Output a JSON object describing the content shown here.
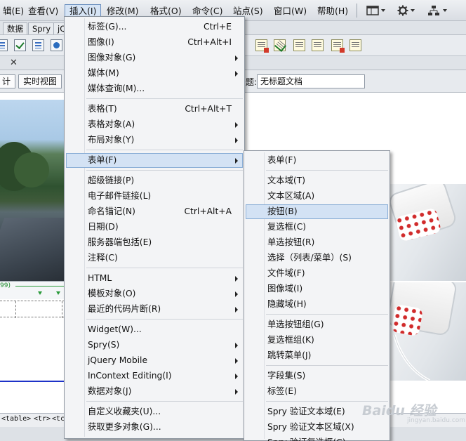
{
  "menubar": {
    "items": [
      "辑(E)",
      "查看(V)",
      "插入(I)",
      "修改(M)",
      "格式(O)",
      "命令(C)",
      "站点(S)",
      "窗口(W)",
      "帮助(H)"
    ],
    "active_index": 2,
    "icons": [
      "layout-icon",
      "gear-icon",
      "site-icon"
    ]
  },
  "panel_tabs": [
    "数据",
    "Spry",
    "jQ"
  ],
  "doc_toolbar": {
    "buttons": [
      "计",
      "实时视图"
    ],
    "title_label": "题:",
    "title_value": "无标题文档"
  },
  "ruler": {
    "width_label": "99)"
  },
  "status_tags": [
    "<table>",
    "<tr>",
    "<tc"
  ],
  "insert_menu": {
    "items": [
      {
        "label": "标签(G)...",
        "shortcut": "Ctrl+E",
        "submenu": false
      },
      {
        "label": "图像(I)",
        "shortcut": "Ctrl+Alt+I",
        "submenu": false
      },
      {
        "label": "图像对象(G)",
        "shortcut": "",
        "submenu": true
      },
      {
        "label": "媒体(M)",
        "shortcut": "",
        "submenu": true
      },
      {
        "label": "媒体查询(M)...",
        "shortcut": "",
        "submenu": false
      },
      {
        "label": "表格(T)",
        "shortcut": "Ctrl+Alt+T",
        "submenu": false
      },
      {
        "label": "表格对象(A)",
        "shortcut": "",
        "submenu": true
      },
      {
        "label": "布局对象(Y)",
        "shortcut": "",
        "submenu": true
      },
      {
        "label": "表单(F)",
        "shortcut": "",
        "submenu": true
      },
      {
        "label": "超级链接(P)",
        "shortcut": "",
        "submenu": false
      },
      {
        "label": "电子邮件链接(L)",
        "shortcut": "",
        "submenu": false
      },
      {
        "label": "命名锚记(N)",
        "shortcut": "Ctrl+Alt+A",
        "submenu": false
      },
      {
        "label": "日期(D)",
        "shortcut": "",
        "submenu": false
      },
      {
        "label": "服务器端包括(E)",
        "shortcut": "",
        "submenu": false
      },
      {
        "label": "注释(C)",
        "shortcut": "",
        "submenu": false
      },
      {
        "label": "HTML",
        "shortcut": "",
        "submenu": true
      },
      {
        "label": "模板对象(O)",
        "shortcut": "",
        "submenu": true
      },
      {
        "label": "最近的代码片断(R)",
        "shortcut": "",
        "submenu": true
      },
      {
        "label": "Widget(W)...",
        "shortcut": "",
        "submenu": false
      },
      {
        "label": "Spry(S)",
        "shortcut": "",
        "submenu": true
      },
      {
        "label": "jQuery Mobile",
        "shortcut": "",
        "submenu": true
      },
      {
        "label": "InContext Editing(I)",
        "shortcut": "",
        "submenu": true
      },
      {
        "label": "数据对象(J)",
        "shortcut": "",
        "submenu": true
      },
      {
        "label": "自定义收藏夹(U)...",
        "shortcut": "",
        "submenu": false
      },
      {
        "label": "获取更多对象(G)...",
        "shortcut": "",
        "submenu": false
      }
    ],
    "highlighted": "表单(F)"
  },
  "form_submenu": {
    "items": [
      "表单(F)",
      "文本域(T)",
      "文本区域(A)",
      "按钮(B)",
      "复选框(C)",
      "单选按钮(R)",
      "选择（列表/菜单）(S)",
      "文件域(F)",
      "图像域(I)",
      "隐藏域(H)",
      "单选按钮组(G)",
      "复选框组(K)",
      "跳转菜单(J)",
      "字段集(S)",
      "标签(E)",
      "Spry 验证文本域(E)",
      "Spry 验证文本区域(X)",
      "Spry 验证复选框(C)"
    ],
    "highlighted": "按钮(B)"
  },
  "watermark": {
    "text": "Baidu 经验",
    "sub": "jingyan.baidu.com"
  },
  "colors": {
    "menu_highlight": "#d3e2f4",
    "menu_highlight_border": "#8aaed6",
    "menu_bg": "#f3f4f6"
  }
}
